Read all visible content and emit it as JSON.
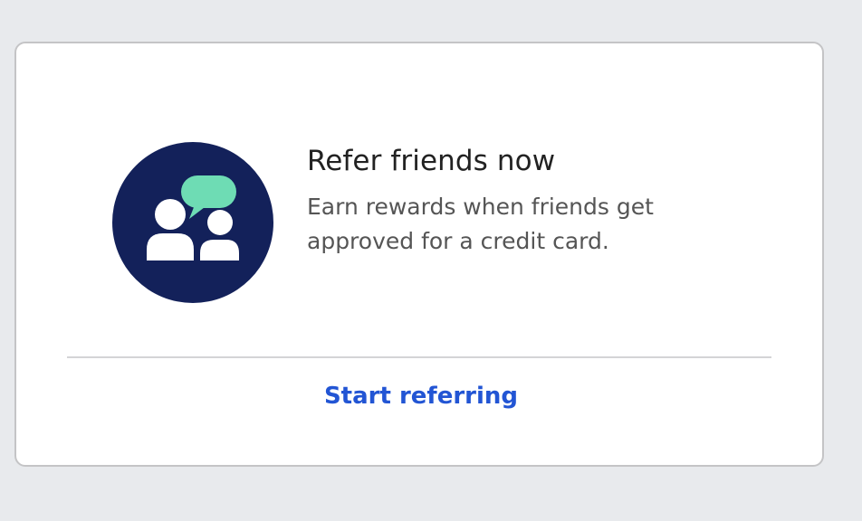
{
  "card": {
    "title": "Refer friends now",
    "description": "Earn rewards when friends get approved for a credit card.",
    "cta_label": "Start referring"
  },
  "icon": {
    "name": "refer-friends-icon",
    "circle_color": "#13215a",
    "bubble_color": "#6edcb4",
    "people_color": "#ffffff"
  },
  "colors": {
    "background": "#e8eaed",
    "card": "#ffffff",
    "link": "#2255d4"
  }
}
